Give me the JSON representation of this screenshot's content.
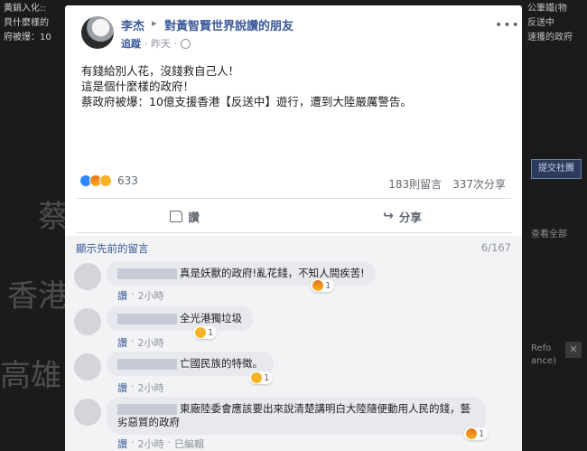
{
  "background": {
    "top_left_text": "黃銷入化::\n貝什麼樣的\n府被爆：10",
    "big_chars": [
      "蔡",
      "香港",
      "高雄"
    ],
    "right_text": "公筆鐵(物\n反送中\n速獲的政府",
    "right_button": "提交社團",
    "right_small_1": "查看全部",
    "right_small_2": "Refo",
    "right_small_3": "ance)",
    "right_close": "✕"
  },
  "post": {
    "author": "李杰",
    "arrow": "▸",
    "group": "對黃智賢世界說讚的朋友",
    "follow": "追蹤",
    "time": "· 昨天 ·",
    "globe_icon": "globe-icon",
    "body_lines": [
      "有錢給別人花，沒錢救自己人！",
      "這是個什麼樣的政府！",
      "蔡政府被爆：10億支援香港【反送中】遊行，遭到大陸嚴厲警告。"
    ],
    "reaction_count": "633",
    "comment_count": "183則留言",
    "share_count": "337次分享",
    "like_label": "讚",
    "share_label": "分享",
    "share_icon": "↪"
  },
  "comments": {
    "sort_label": "顯示先前的留言",
    "page": "6/167",
    "items": [
      {
        "text": "真是妖獸的政府!亂花錢，不知人間疾苦!",
        "react_count": "1",
        "like": "讚",
        "dot": "·",
        "time": "2小時",
        "edited": ""
      },
      {
        "text": "全光港獨垃圾",
        "react_count": "1",
        "like": "讚",
        "dot": "·",
        "time": "2小時",
        "edited": ""
      },
      {
        "text": "亡國民族的特徵。",
        "react_count": "1",
        "like": "讚",
        "dot": "·",
        "time": "2小時",
        "edited": ""
      },
      {
        "text": "東廠陸委會應該要出來說清楚講明白大陸隨便動用人民的錢，藝劣惡質的政府",
        "react_count": "1",
        "like": "讚",
        "dot": "·",
        "time": "2小時",
        "edited": "已編輯"
      }
    ]
  },
  "colors": {
    "link": "#385898",
    "muted": "#90949c",
    "comment_bg": "#e7e9ee"
  }
}
